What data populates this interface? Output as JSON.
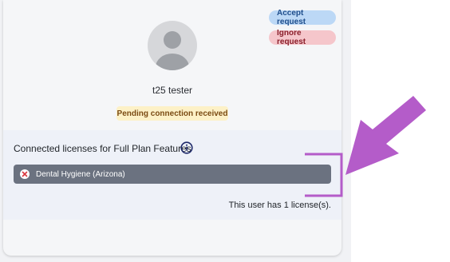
{
  "actions": {
    "accept_label": "Accept request",
    "ignore_label": "Ignore request"
  },
  "profile": {
    "name": "t25 tester",
    "status": "Pending connection received"
  },
  "licenses": {
    "title": "Connected licenses for Full Plan Features",
    "items": [
      {
        "label": "Dental Hygiene (Arizona)"
      }
    ],
    "count_text": "This user has 1 license(s)."
  },
  "colors": {
    "accent_annotation": "#b45cc9",
    "accept_bg": "#bcd8f6",
    "ignore_bg": "#f5c6cb",
    "status_bg": "#fdf1c7",
    "license_pill_bg": "#6b7280",
    "info_icon": "#1f2a6b"
  },
  "icons": {
    "avatar": "user-placeholder-icon",
    "info": "info-icon",
    "remove": "close-circle-icon",
    "annotation": "arrow-annotation-icon"
  }
}
